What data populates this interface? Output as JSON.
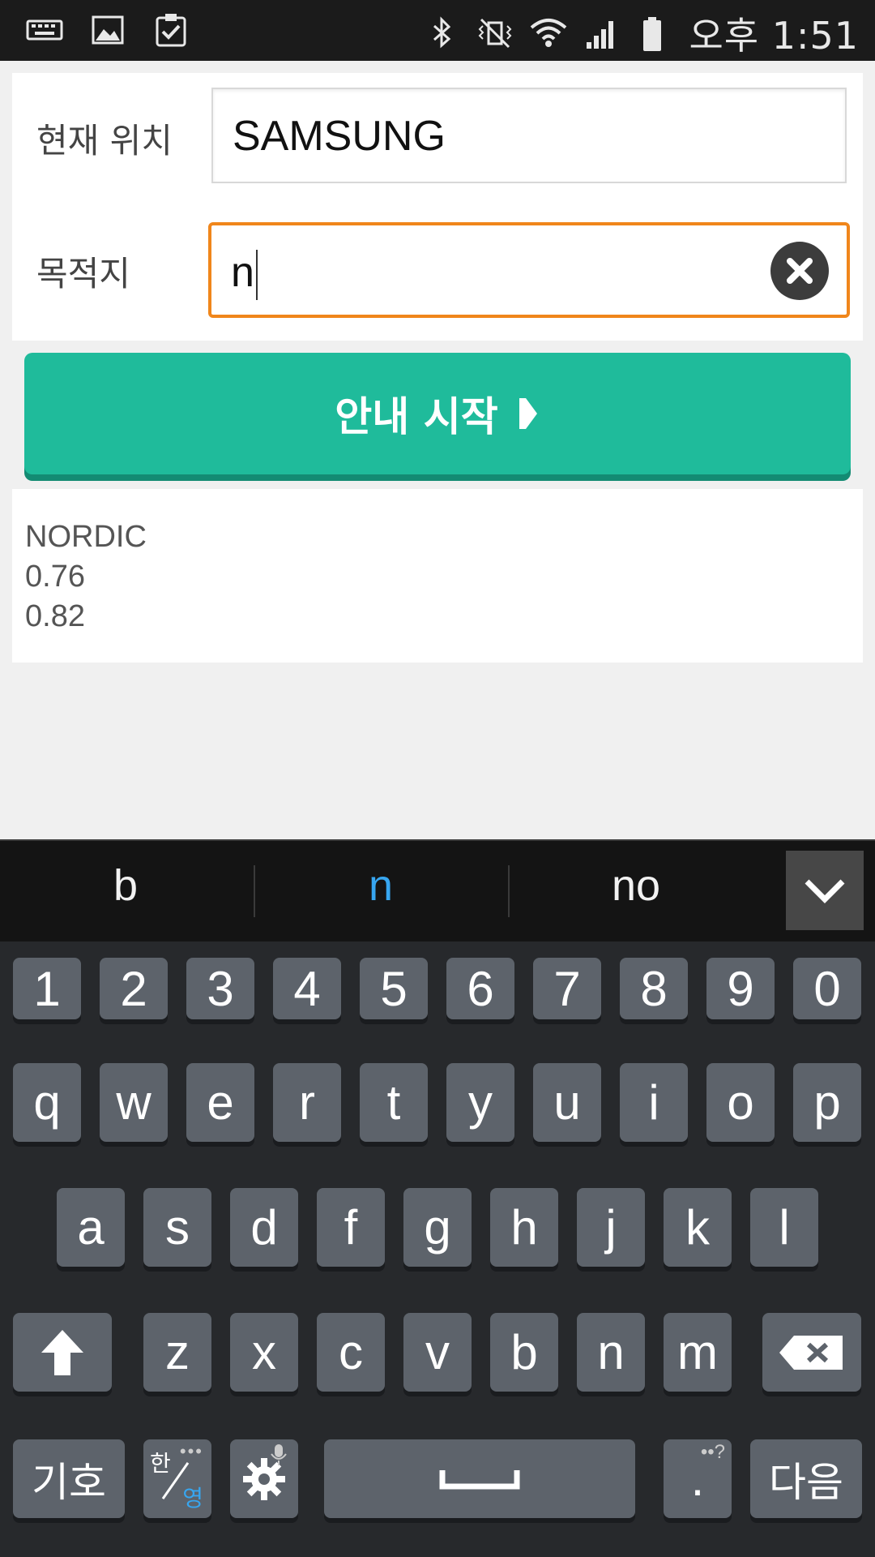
{
  "status_bar": {
    "time": "오후 1:51",
    "left_icons": [
      "keyboard-icon",
      "image-icon",
      "clipboard-check-icon"
    ],
    "right_icons": [
      "bluetooth-icon",
      "vibrate-mute-icon",
      "wifi-icon",
      "signal-icon",
      "battery-icon"
    ]
  },
  "form": {
    "current_location": {
      "label": "현재 위치",
      "value": "SAMSUNG"
    },
    "destination": {
      "label": "목적지",
      "value": "n"
    }
  },
  "start_button": {
    "label": "안내 시작"
  },
  "results": {
    "lines": [
      "NORDIC",
      "0.76",
      "0.82"
    ]
  },
  "keyboard": {
    "suggestions": [
      "b",
      "n",
      "no"
    ],
    "number_row": [
      "1",
      "2",
      "3",
      "4",
      "5",
      "6",
      "7",
      "8",
      "9",
      "0"
    ],
    "row1": [
      "q",
      "w",
      "e",
      "r",
      "t",
      "y",
      "u",
      "i",
      "o",
      "p"
    ],
    "row2": [
      "a",
      "s",
      "d",
      "f",
      "g",
      "h",
      "j",
      "k",
      "l"
    ],
    "row3": [
      "z",
      "x",
      "c",
      "v",
      "b",
      "n",
      "m"
    ],
    "symbol_key": "기호",
    "lang_key": {
      "top": "한",
      "bottom": "영"
    },
    "period_key": ".",
    "next_key": "다음",
    "accent_color": "#37a6f0"
  },
  "colors": {
    "primary": "#1fbb9b",
    "focus": "#f0861b"
  }
}
